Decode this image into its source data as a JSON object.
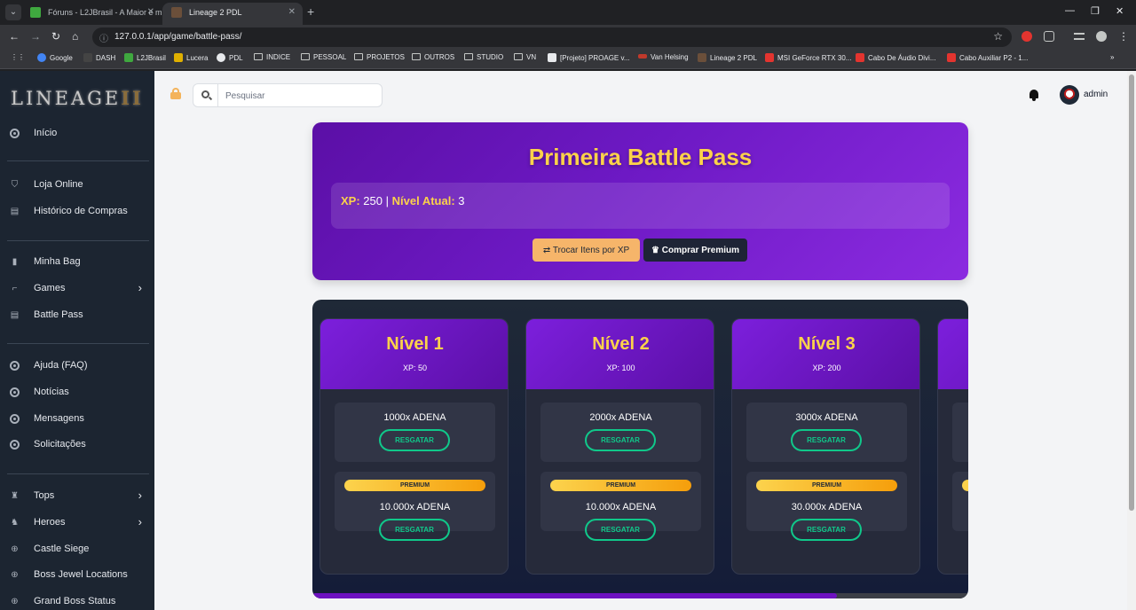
{
  "browser": {
    "tabs": [
      {
        "title": "Fóruns - L2JBrasil - A Maior e m",
        "favicon_color": "#3fa83f",
        "active": false
      },
      {
        "title": "Lineage 2 PDL",
        "favicon_color": "#6b4f3a",
        "active": true
      }
    ],
    "url": "127.0.0.1/app/game/battle-pass/",
    "bookmarks": [
      {
        "label": "Google",
        "type": "site",
        "color": "#4285f4"
      },
      {
        "label": "DASH",
        "type": "site",
        "color": "#444444"
      },
      {
        "label": "L2JBrasil",
        "type": "site",
        "color": "#3fa83f"
      },
      {
        "label": "Lucera",
        "type": "site",
        "color": "#e0b000"
      },
      {
        "label": "PDL",
        "type": "site",
        "color": "#e8eaed"
      },
      {
        "label": "INDICE",
        "type": "folder"
      },
      {
        "label": "PESSOAL",
        "type": "folder"
      },
      {
        "label": "PROJETOS",
        "type": "folder"
      },
      {
        "label": "OUTROS",
        "type": "folder"
      },
      {
        "label": "STUDIO",
        "type": "folder"
      },
      {
        "label": "VN",
        "type": "folder"
      },
      {
        "label": "[Projeto] PROAGE v...",
        "type": "site",
        "color": "#e8eaed"
      },
      {
        "label": "Van Helsing",
        "type": "site",
        "color": "#c0392b"
      },
      {
        "label": "Lineage 2 PDL",
        "type": "site",
        "color": "#6b4f3a"
      },
      {
        "label": "MSI GeForce RTX 30...",
        "type": "site",
        "color": "#e3342f"
      },
      {
        "label": "Cabo De Áudio Divi...",
        "type": "site",
        "color": "#e3342f"
      },
      {
        "label": "Cabo Auxiliar P2 - 1...",
        "type": "site",
        "color": "#e3342f"
      }
    ]
  },
  "sidebar": {
    "logo": "LINEAGE",
    "logo_suffix": "II",
    "items": [
      {
        "label": "Início",
        "icon": "circle-icon",
        "chevron": false
      },
      {
        "label": "Loja Online",
        "icon": "cart-icon",
        "chevron": false
      },
      {
        "label": "Histórico de Compras",
        "icon": "receipt-icon",
        "chevron": false
      },
      {
        "label": "Minha Bag",
        "icon": "bag-icon",
        "chevron": false
      },
      {
        "label": "Games",
        "icon": "gamepad-icon",
        "chevron": true
      },
      {
        "label": "Battle Pass",
        "icon": "document-icon",
        "chevron": false
      },
      {
        "label": "Ajuda (FAQ)",
        "icon": "circle-icon",
        "chevron": false
      },
      {
        "label": "Notícias",
        "icon": "circle-icon",
        "chevron": false
      },
      {
        "label": "Mensagens",
        "icon": "circle-icon",
        "chevron": false
      },
      {
        "label": "Solicitações",
        "icon": "circle-icon",
        "chevron": false
      },
      {
        "label": "Tops",
        "icon": "trophy-icon",
        "chevron": true
      },
      {
        "label": "Heroes",
        "icon": "helmet-icon",
        "chevron": true
      },
      {
        "label": "Castle Siege",
        "icon": "plus-circle-icon",
        "chevron": false
      },
      {
        "label": "Boss Jewel Locations",
        "icon": "plus-circle-icon",
        "chevron": false
      },
      {
        "label": "Grand Boss Status",
        "icon": "plus-circle-icon",
        "chevron": false
      }
    ]
  },
  "topbar": {
    "search_placeholder": "Pesquisar",
    "username": "admin"
  },
  "battle_pass": {
    "title": "Primeira Battle Pass",
    "xp_label": "XP:",
    "xp_value": "250",
    "separator": "|",
    "level_label": "Nível Atual:",
    "level_value": "3",
    "exchange_button": "Trocar Itens por XP",
    "premium_button": "Comprar Premium",
    "scroll_progress": 0.8,
    "levels": [
      {
        "title": "Nível 1",
        "xp": "XP: 50",
        "free_reward": "1000x ADENA",
        "premium_reward": "10.000x ADENA"
      },
      {
        "title": "Nível 2",
        "xp": "XP: 100",
        "free_reward": "2000x ADENA",
        "premium_reward": "10.000x ADENA"
      },
      {
        "title": "Nível 3",
        "xp": "XP: 200",
        "free_reward": "3000x ADENA",
        "premium_reward": "30.000x ADENA"
      }
    ],
    "claim_label": "RESGATAR",
    "premium_badge": "PREMIUM"
  },
  "colors": {
    "accent_gold": "#fcd24a",
    "purple": "#6d19c4",
    "claim_green": "#10c88a"
  }
}
